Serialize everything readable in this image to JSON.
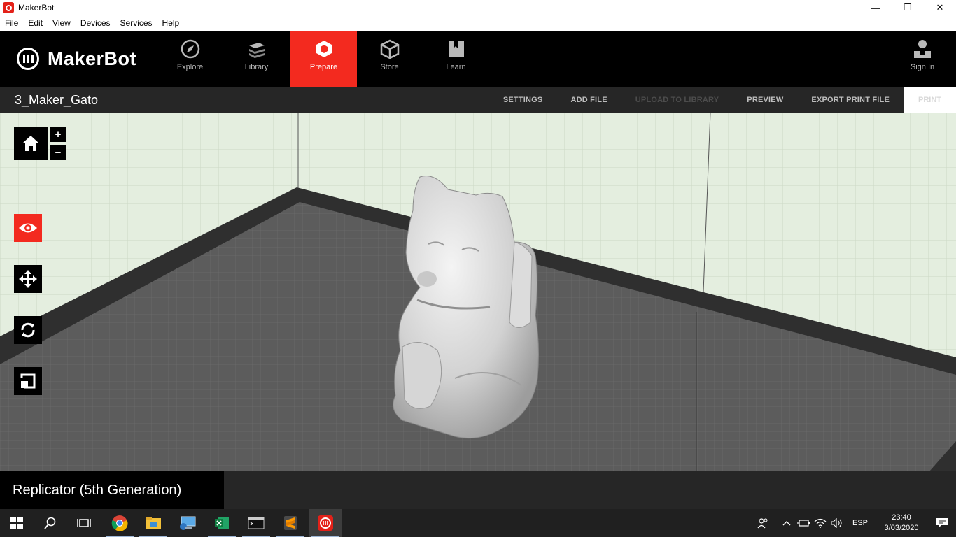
{
  "window": {
    "title": "MakerBot",
    "minimize": "—",
    "restore": "❐",
    "close": "✕"
  },
  "menu": [
    "File",
    "Edit",
    "View",
    "Devices",
    "Services",
    "Help"
  ],
  "brand": {
    "name": "MakerBot"
  },
  "nav": {
    "tabs": [
      {
        "label": "Explore",
        "icon": "compass-icon"
      },
      {
        "label": "Library",
        "icon": "library-icon"
      },
      {
        "label": "Prepare",
        "icon": "prepare-icon",
        "active": true
      },
      {
        "label": "Store",
        "icon": "store-box-icon"
      },
      {
        "label": "Learn",
        "icon": "book-icon"
      }
    ],
    "signin": "Sign In"
  },
  "project": {
    "file_name": "3_Maker_Gato",
    "actions": {
      "settings": "SETTINGS",
      "add_file": "ADD FILE",
      "upload": "UPLOAD TO LIBRARY",
      "preview": "PREVIEW",
      "export": "EXPORT PRINT FILE",
      "print": "PRINT"
    }
  },
  "tools": {
    "zoom_in": "+",
    "zoom_out": "−"
  },
  "printer": {
    "name": "Replicator (5th Generation)"
  },
  "colors": {
    "accent": "#f32a1f",
    "plate": "#5c5c5c",
    "plate_border": "#2f2f2f",
    "wall": "#e4eedf"
  },
  "taskbar": {
    "apps": [
      "start-icon",
      "search-icon",
      "task-view-icon",
      "chrome-icon",
      "file-explorer-icon",
      "network-icon",
      "excel-icon",
      "terminal-icon",
      "sublime-text-icon",
      "makerbot-icon"
    ],
    "language": "ESP",
    "time": "23:40",
    "date": "3/03/2020"
  }
}
